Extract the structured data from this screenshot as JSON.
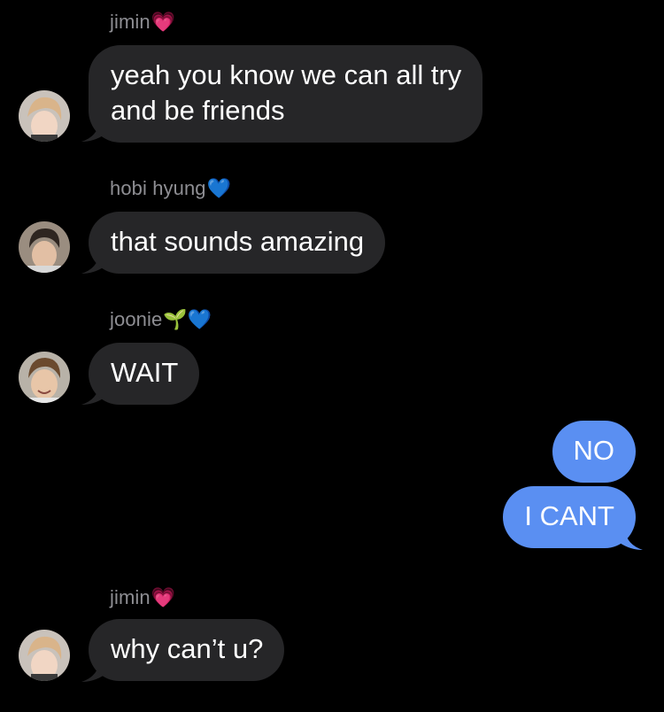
{
  "conversation": {
    "messages": [
      {
        "sender": "jimin",
        "sender_emoji": "💗",
        "text": "yeah you know we can all try and be friends",
        "line1": "yeah you know we can all try",
        "line2": "and be friends"
      },
      {
        "sender": "hobi hyung",
        "sender_emoji": "💙",
        "text": "that sounds amazing"
      },
      {
        "sender": "joonie",
        "sender_emoji": "🌱💙",
        "text": "WAIT"
      },
      {
        "sender": "me",
        "text": "NO"
      },
      {
        "sender": "me",
        "text": "I CANT"
      },
      {
        "sender": "jimin",
        "sender_emoji": "💗",
        "text": "why can’t u?"
      }
    ]
  },
  "colors": {
    "background": "#000000",
    "incoming_bubble": "#262628",
    "outgoing_bubble": "#5a8ff2",
    "sender_name": "#8e8e93",
    "text": "#ffffff"
  }
}
